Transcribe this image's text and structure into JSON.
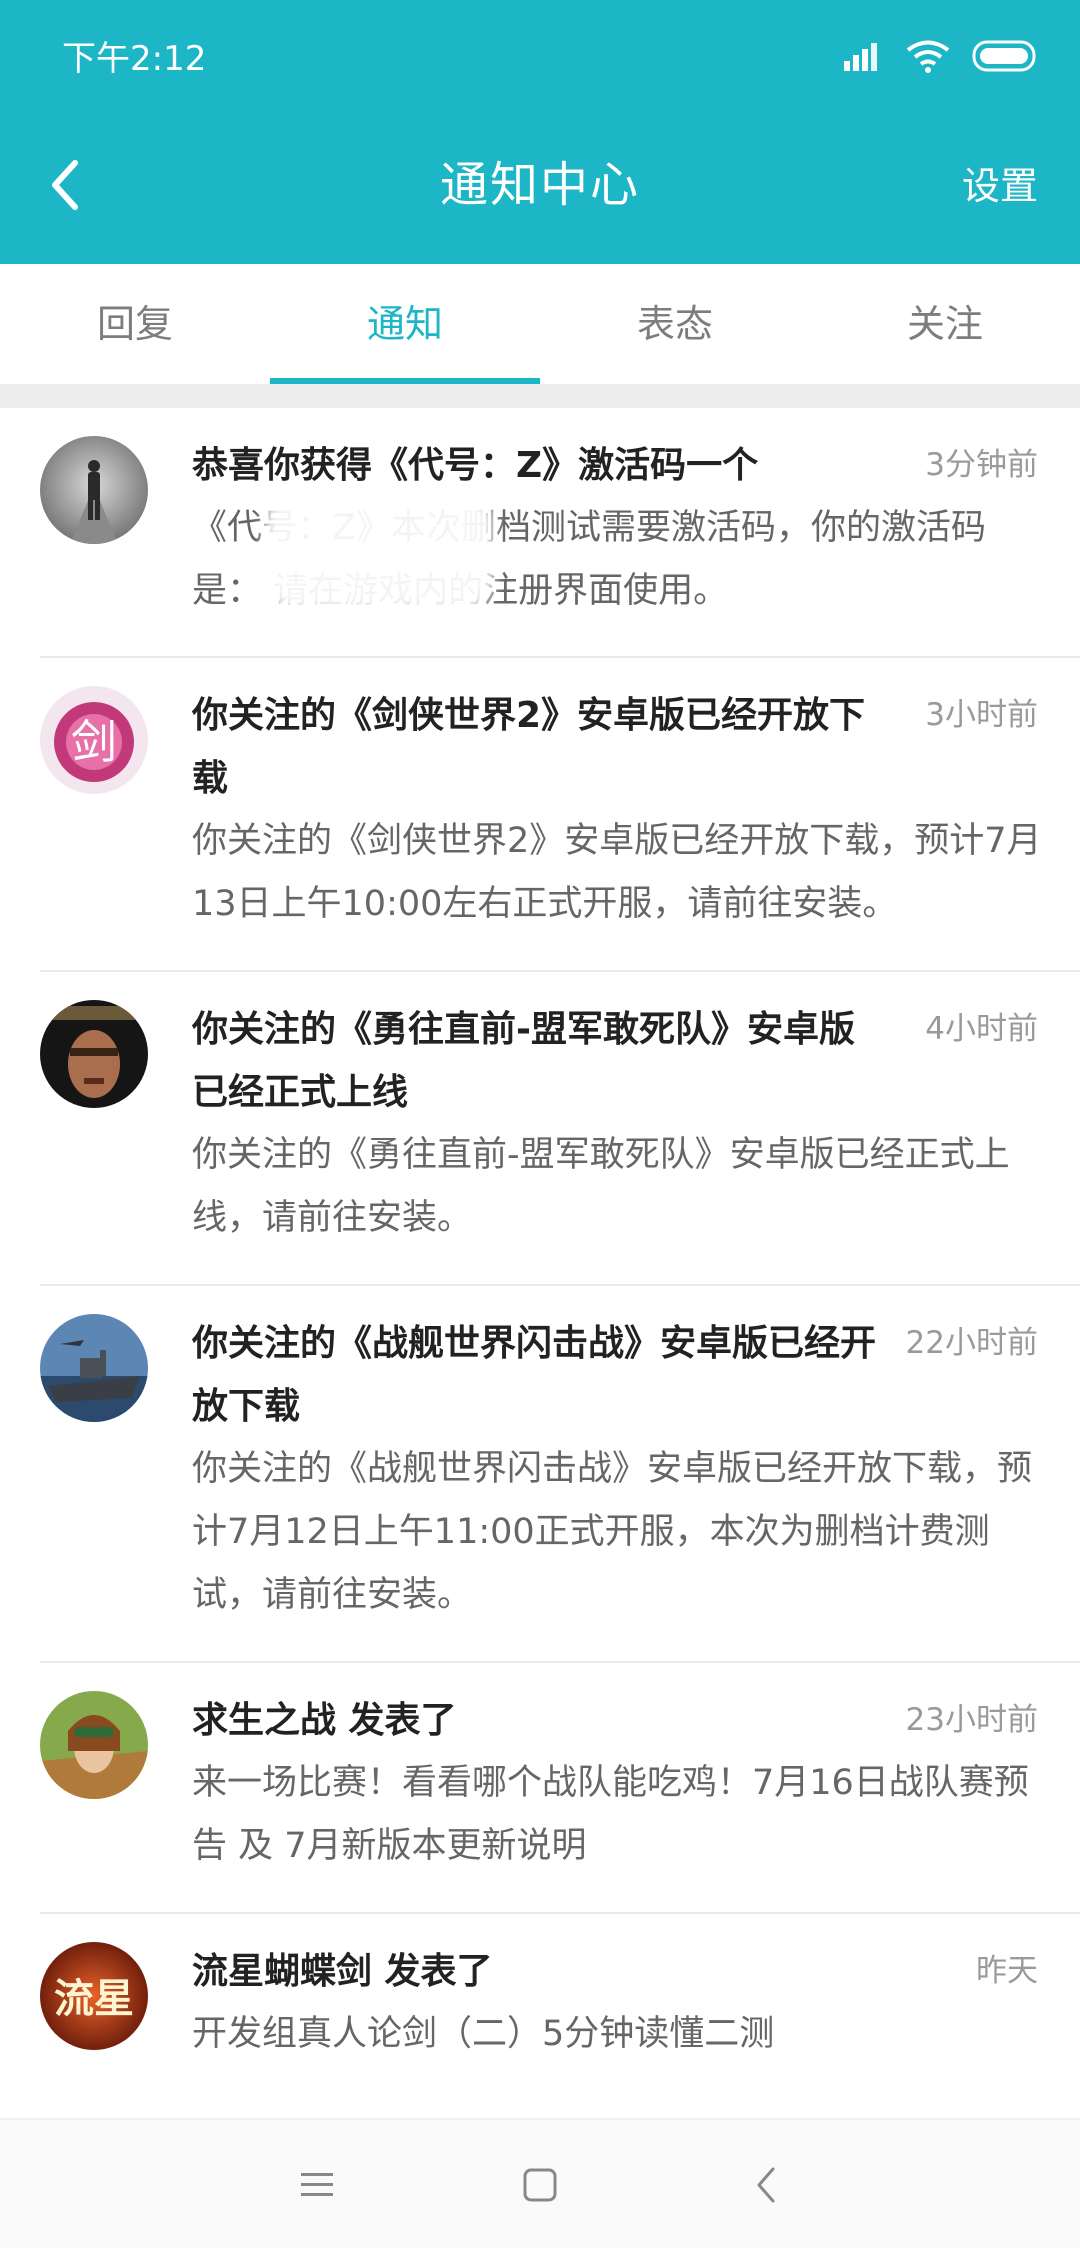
{
  "status_bar": {
    "time": "下午2:12"
  },
  "nav": {
    "title": "通知中心",
    "settings_label": "设置"
  },
  "tabs": [
    {
      "label": "回复",
      "active": false
    },
    {
      "label": "通知",
      "active": true
    },
    {
      "label": "表态",
      "active": false
    },
    {
      "label": "关注",
      "active": false
    }
  ],
  "notifications": [
    {
      "title": "恭喜你获得《代号：Z》激活码一个",
      "time": "3分钟前",
      "body": "《代号：Z》本次删档测试需要激活码，你的激活码是：                 请在游戏内的注册界面使用。",
      "avatar_icon": "walking-man-avatar"
    },
    {
      "title": "你关注的《剑侠世界2》安卓版已经开放下载",
      "time": "3小时前",
      "body": "你关注的《剑侠世界2》安卓版已经开放下载，预计7月13日上午10:00左右正式开服，请前往安装。",
      "avatar_icon": "jianxia-game-avatar"
    },
    {
      "title": "你关注的《勇往直前-盟军敢死队》安卓版已经正式上线",
      "time": "4小时前",
      "body": "你关注的《勇往直前-盟军敢死队》安卓版已经正式上线，请前往安装。",
      "avatar_icon": "commandos-game-avatar"
    },
    {
      "title": "你关注的《战舰世界闪击战》安卓版已经开放下载",
      "time": "22小时前",
      "body": "你关注的《战舰世界闪击战》安卓版已经开放下载，预计7月12日上午11:00正式开服，本次为删档计费测试，请前往安装。",
      "avatar_icon": "warship-game-avatar"
    },
    {
      "title": "求生之战 发表了",
      "time": "23小时前",
      "body": "来一场比赛！看看哪个战队能吃鸡！7月16日战队赛预告 及 7月新版本更新说明",
      "avatar_icon": "survival-game-avatar"
    },
    {
      "title": "流星蝴蝶剑 发表了",
      "time": "昨天",
      "body": "开发组真人论剑（二）5分钟读懂二测",
      "avatar_icon": "meteor-sword-avatar"
    }
  ],
  "colors": {
    "accent": "#1cb6c6",
    "title_text": "#222222",
    "body_text": "#666666",
    "time_text": "#9a9a9a"
  }
}
